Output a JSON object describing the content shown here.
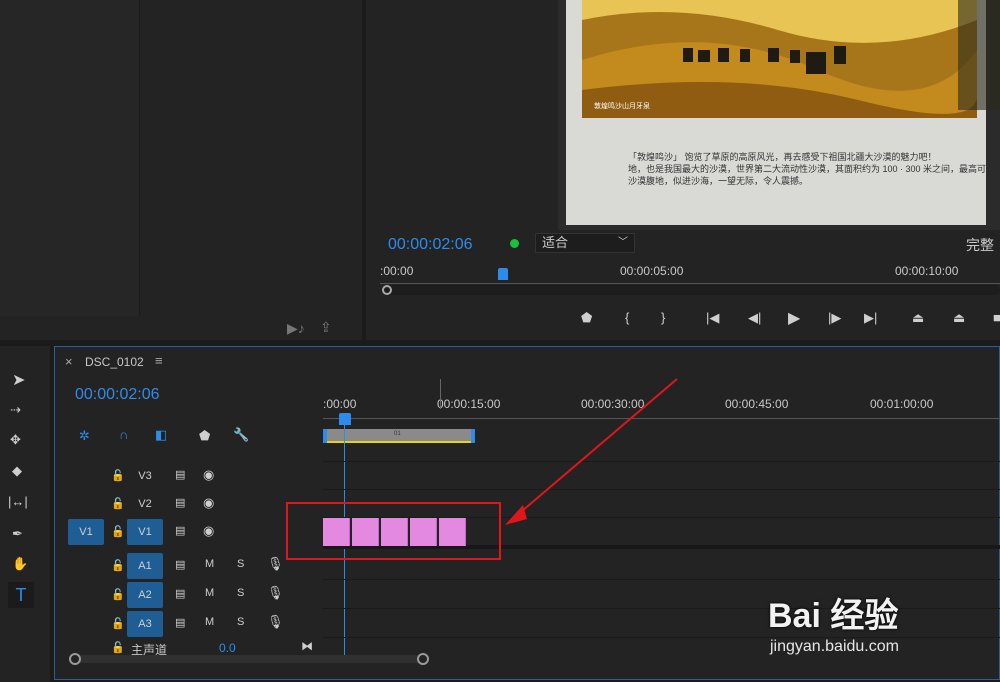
{
  "source_panel": {
    "footer_icons": [
      "insert-audio-icon",
      "export-icon"
    ]
  },
  "program": {
    "timecode": "00:00:02:06",
    "fit": "适合",
    "quality": "完整",
    "ruler": [
      ":00:00",
      "00:00:05:00",
      "00:00:10:00"
    ],
    "video_caption": "敦煌鸣沙山月牙泉",
    "video_text_line1": "「敦煌鸣沙」 饱览了草原的高原风光，再去感受下祖国北疆大沙漠的魅力吧！",
    "video_text_line2": "地，也是我国最大的沙漠，世界第二大流动性沙漠，其面积约为 100 · 300 米之间，最高可",
    "video_text_line3": "沙漠腹地，似进沙海，一望无际，令人震撼。",
    "transport": [
      "marker-icon",
      "mark-in-icon",
      "mark-out-icon",
      "go-to-in-icon",
      "step-back-icon",
      "play-icon",
      "step-forward-icon",
      "go-to-out-icon",
      "lift-icon",
      "extract-icon",
      "export-frame-icon"
    ]
  },
  "timeline": {
    "tab_close": "×",
    "sequence_name": "DSC_0102",
    "menu": "≡",
    "timecode": "00:00:02:06",
    "ruler": [
      ":00:00",
      "00:00:15:00",
      "00:00:30:00",
      "00:00:45:00",
      "00:01:00:00"
    ],
    "work_area_label": "01",
    "video_tracks": [
      {
        "name": "V3",
        "source": ""
      },
      {
        "name": "V2",
        "source": ""
      },
      {
        "name": "V1",
        "source": "V1"
      }
    ],
    "audio_tracks": [
      {
        "name": "A1",
        "m": "M",
        "s": "S"
      },
      {
        "name": "A2",
        "m": "M",
        "s": "S"
      },
      {
        "name": "A3",
        "m": "M",
        "s": "S"
      }
    ],
    "master": {
      "name": "主声道",
      "value": "0.0"
    }
  },
  "watermark": {
    "brand": "Bai 经验",
    "url": "jingyan.baidu.com"
  },
  "colors": {
    "accent": "#2d8ceb",
    "clip": "#e38ae0",
    "annotation": "#e0161b",
    "track_active": "#1e5e94"
  }
}
